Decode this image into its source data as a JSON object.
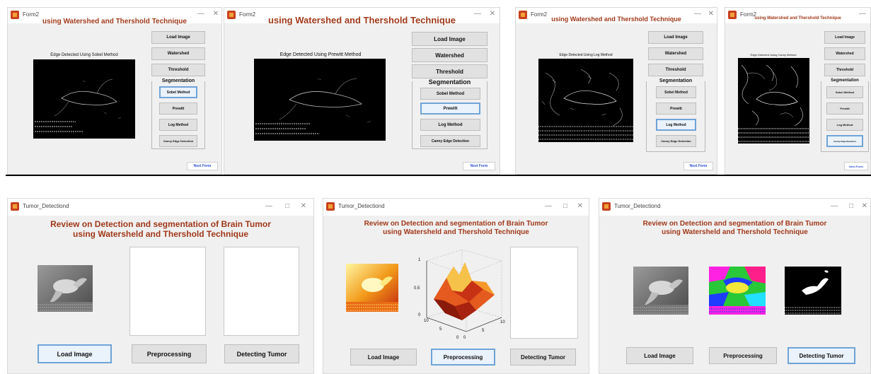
{
  "top_windows": [
    {
      "title": "Form2",
      "heading": "using Watershed and Thershold Technique",
      "edge_label": "Edge Detected Using Sobel Method",
      "selected": "sobel"
    },
    {
      "title": "Form2",
      "heading": "using Watershed and Thershold Technique",
      "edge_label": "Edge Detected Using Prewitt Method",
      "selected": "prewitt"
    },
    {
      "title": "Form2",
      "heading": "using Watershed and Thershold Technique",
      "edge_label": "Edge Detected Using Log Method",
      "selected": "log"
    },
    {
      "title": "Form2",
      "heading": "using Watershed and Thershold Technique",
      "edge_label": "Edge Detected Using Canny Method",
      "selected": "canny"
    }
  ],
  "form2_buttons": {
    "load_image": "Load Image",
    "watershed": "Watershed",
    "threshold": "Threshold",
    "segmentation_group": "Segmentation",
    "sobel": "Sobel Method",
    "prewitt": "Prewitt",
    "log": "Log Method",
    "canny": "Canny Edge Detection",
    "next_form": "Next Form"
  },
  "bottom_windows": [
    {
      "title": "Tumor_Detectiond",
      "selected": "load"
    },
    {
      "title": "Tumor_Detectiond",
      "selected": "pre"
    },
    {
      "title": "Tumor_Detectiond",
      "selected": "detect"
    }
  ],
  "tumor_form": {
    "heading_line1": "Review on Detection and segmentation of Brain Tumor",
    "heading_line2": "using Watersheld and Thershold Technique",
    "load_image": "Load Image",
    "preprocessing": "Preprocessing",
    "detecting_tumor": "Detecting Tumor"
  },
  "surface_plot": {
    "z_ticks": [
      "1",
      "0.5",
      "0"
    ],
    "x_ticks": [
      "0",
      "5",
      "10"
    ],
    "y_ticks": [
      "10",
      "5",
      "0"
    ]
  },
  "window_controls": {
    "minimize": "—",
    "maximize": "□",
    "close": "✕"
  },
  "colors": {
    "heading": "#a0391a",
    "selected_border": "#6fa4d8",
    "next_form_text": "#2b4fd1"
  }
}
